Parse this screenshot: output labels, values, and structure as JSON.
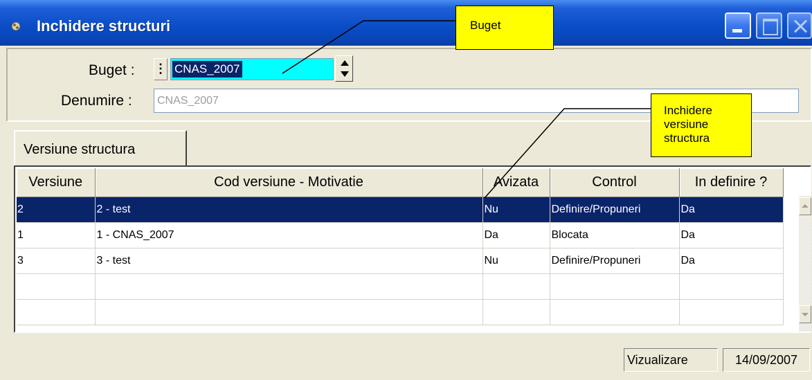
{
  "window": {
    "title": "Inchidere structuri"
  },
  "form": {
    "buget_label": "Buget :",
    "buget_value": "CNAS_2007",
    "denumire_label": "Denumire :",
    "denumire_value": "CNAS_2007"
  },
  "tabs": [
    {
      "label": "Versiune structura",
      "selected": true
    }
  ],
  "grid": {
    "columns": [
      "Versiune",
      "Cod versiune - Motivatie",
      "Avizata",
      "Control",
      "In definire ?"
    ],
    "rows": [
      {
        "versiune": "2",
        "cod": "2 - test",
        "avizata": "Nu",
        "control": "Definire/Propuneri",
        "definire": "Da",
        "selected": true
      },
      {
        "versiune": "1",
        "cod": "1 - CNAS_2007",
        "avizata": "Da",
        "control": "Blocata",
        "definire": "Da",
        "selected": false
      },
      {
        "versiune": "3",
        "cod": "3 - test",
        "avizata": "Nu",
        "control": "Definire/Propuneri",
        "definire": "Da",
        "selected": false
      }
    ],
    "empty_rows": 2
  },
  "status": {
    "mode": "Vizualizare",
    "date": "14/09/2007"
  },
  "callouts": {
    "buget": "Buget",
    "inchidere_line1": "Inchidere",
    "inchidere_line2": "versiune",
    "inchidere_line3": "structura"
  },
  "colors": {
    "titlebar": "#0a4ec8",
    "selection": "#0a246a",
    "buget_input_bg": "#00ffff",
    "callout_bg": "#ffff00",
    "window_bg": "#ece9d8"
  }
}
